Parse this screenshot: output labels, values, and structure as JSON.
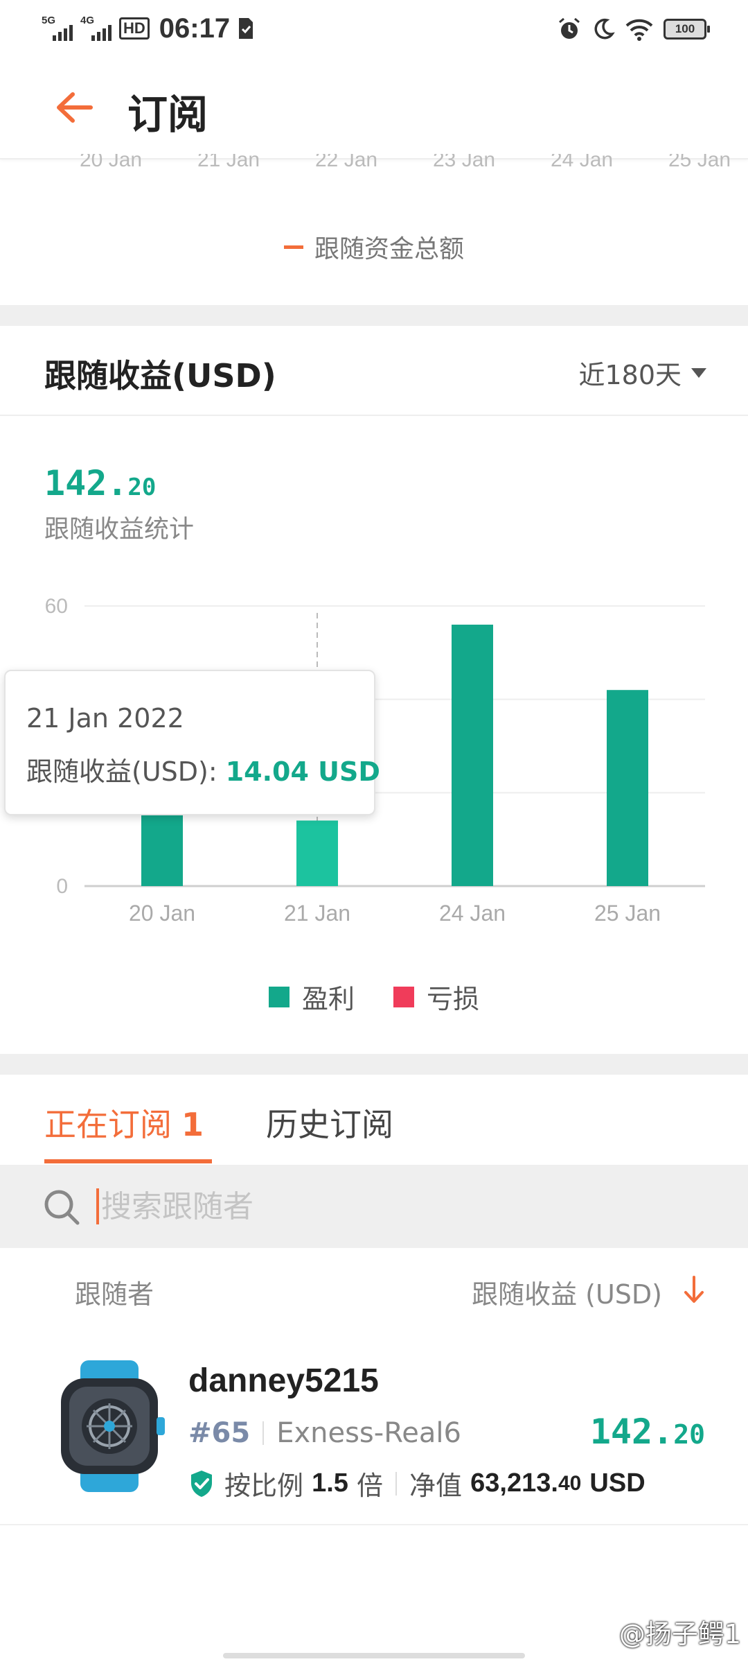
{
  "status_bar": {
    "net1": "5G",
    "net2": "4G",
    "hd": "HD",
    "time": "06:17",
    "battery": "100"
  },
  "header": {
    "title": "订阅"
  },
  "top_chart": {
    "x_labels": [
      "20 Jan",
      "21 Jan",
      "22 Jan",
      "23 Jan",
      "24 Jan",
      "25 Jan"
    ],
    "legend": "跟随资金总额",
    "legend_color": "#f36d3a"
  },
  "income": {
    "title": "跟随收益(USD)",
    "range": "近180天",
    "total_int": "142.",
    "total_dec": "20",
    "total_label": "跟随收益统计"
  },
  "chart_data": {
    "type": "bar",
    "categories": [
      "20 Jan",
      "21 Jan",
      "24 Jan",
      "25 Jan"
    ],
    "series": [
      {
        "name": "盈利",
        "color": "#13a88b",
        "values": [
          15.5,
          14.04,
          56,
          42
        ]
      },
      {
        "name": "亏损",
        "color": "#f03c5a",
        "values": [
          0,
          0,
          0,
          0
        ]
      }
    ],
    "y_ticks": [
      "0",
      "60"
    ],
    "ylim": [
      0,
      60
    ],
    "grid": true,
    "highlight_index": 1,
    "tooltip": {
      "date": "21 Jan 2022",
      "label": "跟随收益(USD): ",
      "value": "14.04 USD"
    }
  },
  "tabs": {
    "active_label": "正在订阅",
    "active_count": "1",
    "history_label": "历史订阅"
  },
  "search": {
    "placeholder": "搜索跟随者",
    "value": ""
  },
  "list_header": {
    "left": "跟随者",
    "right": "跟随收益 (USD)"
  },
  "followers": [
    {
      "name": "danney5215",
      "rank": "#65",
      "server": "Exness-Real6",
      "profit_int": "142.",
      "profit_dec": "20",
      "ratio_label": "按比例",
      "ratio_value": "1.5",
      "ratio_unit": "倍",
      "equity_label": "净值",
      "equity_int": "63,213.",
      "equity_dec": "40",
      "equity_unit": "USD"
    }
  ],
  "watermark": "@扬子鳄1",
  "colors": {
    "accent": "#f36d3a",
    "profit": "#13a88b",
    "loss": "#f03c5a"
  }
}
